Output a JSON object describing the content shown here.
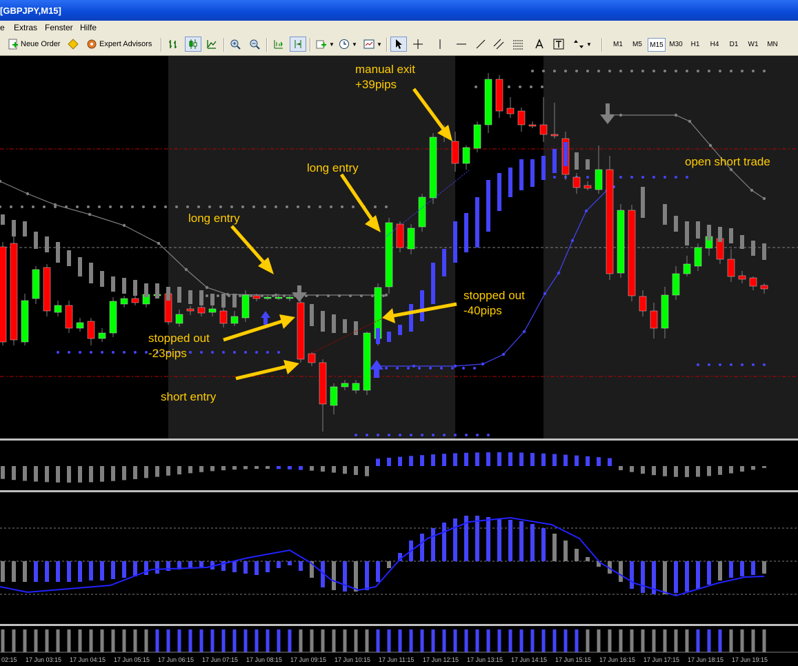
{
  "window": {
    "title": "[GBPJPY,M15]"
  },
  "menu": [
    "e",
    "Extras",
    "Fenster",
    "Hilfe"
  ],
  "toolbar": {
    "new_order": "Neue Order",
    "expert_advisors": "Expert Advisors",
    "timeframes": [
      "M1",
      "M5",
      "M15",
      "M30",
      "H1",
      "H4",
      "D1",
      "W1",
      "MN"
    ],
    "active_timeframe": "M15"
  },
  "annotations": {
    "manual_exit": [
      "manual exit",
      "+39pips"
    ],
    "long_entry_1": "long entry",
    "long_entry_2": "long entry",
    "stopped_out_1": [
      "stopped out",
      "-23pips"
    ],
    "stopped_out_2": [
      "stopped out",
      "-40pips"
    ],
    "short_entry": "short entry",
    "open_short": "open short trade"
  },
  "colors": {
    "bull": "#00ff00",
    "bear": "#ff0000",
    "neutral": "#808080",
    "blue": "#4444ff",
    "annotation": "#ffcc00",
    "session_shade": "#1c1c1c"
  },
  "time_axis": [
    "02:15",
    "17 Jun 03:15",
    "17 Jun 04:15",
    "17 Jun 05:15",
    "17 Jun 06:15",
    "17 Jun 07:15",
    "17 Jun 08:15",
    "17 Jun 09:15",
    "17 Jun 10:15",
    "17 Jun 11:15",
    "17 Jun 12:15",
    "17 Jun 13:15",
    "17 Jun 14:15",
    "17 Jun 15:15",
    "17 Jun 16:15",
    "17 Jun 17:15",
    "17 Jun 18:15",
    "17 Jun 19:15"
  ]
}
